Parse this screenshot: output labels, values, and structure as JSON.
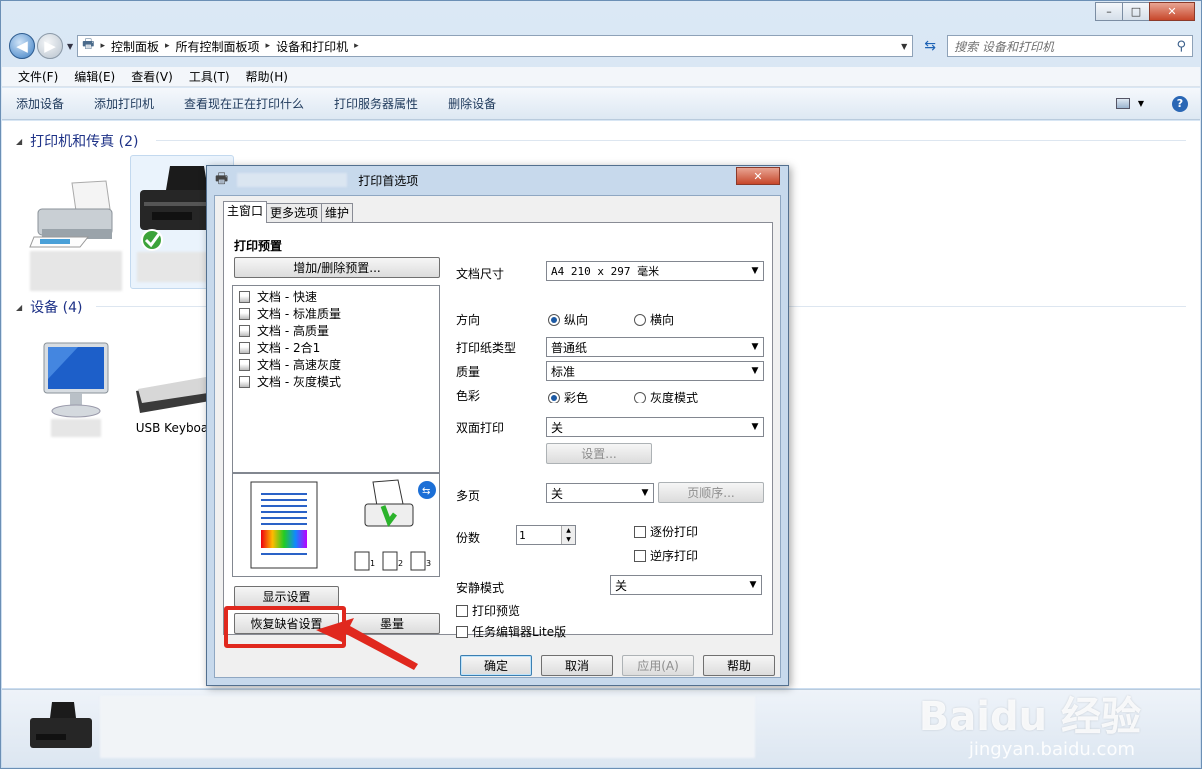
{
  "window": {
    "min": "–",
    "max": "□",
    "close": "✕"
  },
  "address": {
    "crumbs": [
      "控制面板",
      "所有控制面板项",
      "设备和打印机"
    ],
    "search_placeholder": "搜索 设备和打印机"
  },
  "menu": [
    "文件(F)",
    "编辑(E)",
    "查看(V)",
    "工具(T)",
    "帮助(H)"
  ],
  "commands": [
    "添加设备",
    "添加打印机",
    "查看现在正在打印什么",
    "打印服务器属性",
    "删除设备"
  ],
  "groups": {
    "printers": "打印机和传真 (2)",
    "devices": "设备 (4)"
  },
  "devices": {
    "keyboard": "USB Keyboa"
  },
  "dialog": {
    "title": "打印首选项",
    "tabs": [
      "主窗口",
      "更多选项",
      "维护"
    ],
    "preset_heading": "打印预置",
    "add_remove_preset": "增加/删除预置...",
    "presets": [
      "文档 - 快速",
      "文档 - 标准质量",
      "文档 - 高质量",
      "文档 - 2合1",
      "文档 - 高速灰度",
      "文档 - 灰度模式"
    ],
    "show_settings": "显示设置",
    "restore_defaults": "恢复缺省设置",
    "ink_levels": "墨量",
    "doc_size_label": "文档尺寸",
    "doc_size_value": "A4 210 x 297 毫米",
    "orientation_label": "方向",
    "portrait": "纵向",
    "landscape": "横向",
    "paper_type_label": "打印纸类型",
    "paper_type_value": "普通纸",
    "quality_label": "质量",
    "quality_value": "标准",
    "color_label": "色彩",
    "color": "彩色",
    "grayscale": "灰度模式",
    "duplex_label": "双面打印",
    "duplex_value": "关",
    "duplex_settings": "设置...",
    "multipage_label": "多页",
    "multipage_value": "关",
    "page_order": "页顺序...",
    "copies_label": "份数",
    "copies_value": "1",
    "collate": "逐份打印",
    "reverse": "逆序打印",
    "quiet_label": "安静模式",
    "quiet_value": "关",
    "print_preview": "打印预览",
    "job_arranger": "任务编辑器Lite版",
    "ok": "确定",
    "cancel": "取消",
    "apply": "应用(A)",
    "help": "帮助",
    "close": "✕"
  },
  "watermark": {
    "brand": "Baidu 经验",
    "url": "jingyan.baidu.com"
  }
}
